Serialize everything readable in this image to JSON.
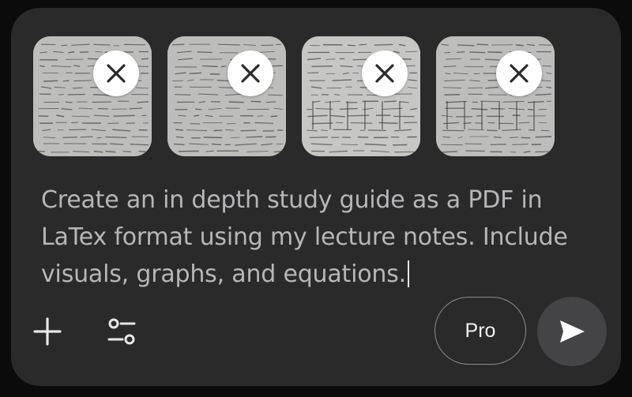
{
  "attachments": [
    {
      "icon": "note-photo-thumbnail",
      "remove_icon": "close-icon"
    },
    {
      "icon": "note-photo-thumbnail",
      "remove_icon": "close-icon"
    },
    {
      "icon": "note-photo-thumbnail",
      "remove_icon": "close-icon"
    },
    {
      "icon": "note-photo-thumbnail",
      "remove_icon": "close-icon"
    }
  ],
  "prompt": {
    "text": "Create an in depth study guide as a PDF in LaTex format using my lecture notes. Include visuals, graphs, and equations."
  },
  "toolbar": {
    "add_icon": "plus-icon",
    "tools_icon": "sliders-icon",
    "mode_label": "Pro",
    "send_icon": "send-icon"
  },
  "colors": {
    "panel": "#2a2a2b",
    "text": "#b7b7b9",
    "send_bg": "#444446"
  }
}
